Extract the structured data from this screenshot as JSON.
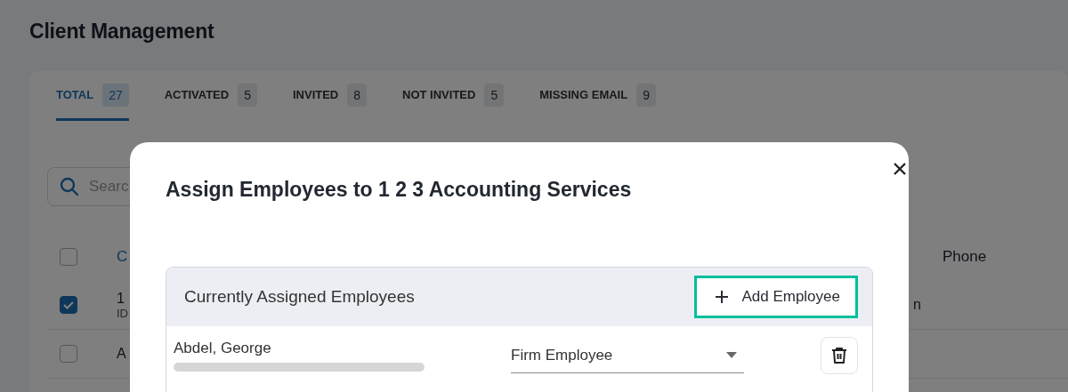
{
  "page": {
    "title": "Client Management"
  },
  "tabs": [
    {
      "label": "TOTAL",
      "count": "27",
      "selected": true
    },
    {
      "label": "ACTIVATED",
      "count": "5",
      "selected": false
    },
    {
      "label": "INVITED",
      "count": "8",
      "selected": false
    },
    {
      "label": "NOT INVITED",
      "count": "5",
      "selected": false
    },
    {
      "label": "MISSING EMAIL",
      "count": "9",
      "selected": false
    }
  ],
  "search": {
    "placeholder": "Searc"
  },
  "table": {
    "columns": [
      "C",
      "Phone"
    ],
    "select_all": {
      "checked": false
    },
    "rows": [
      {
        "checked": true,
        "name": "1",
        "id": "ID",
        "column_3": "n"
      },
      {
        "checked": false,
        "name": "A"
      }
    ]
  },
  "modal": {
    "title": "Assign Employees to 1 2 3 Accounting Services",
    "panel": {
      "title": "Currently Assigned Employees",
      "add_button": "Add Employee",
      "employees": [
        {
          "name": "Abdel, George",
          "role": "Firm Employee"
        }
      ]
    }
  }
}
